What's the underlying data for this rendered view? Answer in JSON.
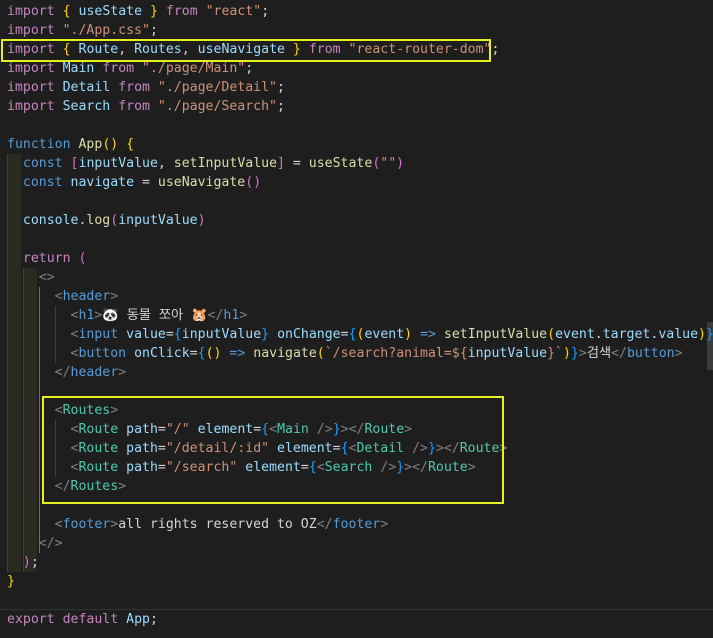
{
  "editor": {
    "language": "javascript-react",
    "theme_colors": {
      "background": "#1e1e1e",
      "highlight_box": "#e6f01e",
      "keyword": "#569cd6",
      "control_keyword": "#c586c0",
      "function": "#dcdcaa",
      "variable": "#9cdcfe",
      "string": "#ce9178",
      "component": "#4ec9b0"
    },
    "lines": [
      {
        "segs": [
          [
            "kw2",
            "import"
          ],
          [
            "txt",
            " "
          ],
          [
            "br1",
            "{"
          ],
          [
            "txt",
            " "
          ],
          [
            "var",
            "useState"
          ],
          [
            "txt",
            " "
          ],
          [
            "br1",
            "}"
          ],
          [
            "txt",
            " "
          ],
          [
            "kw2",
            "from"
          ],
          [
            "txt",
            " "
          ],
          [
            "str",
            "\"react\""
          ],
          [
            "txt",
            ";"
          ]
        ]
      },
      {
        "segs": [
          [
            "kw2",
            "import"
          ],
          [
            "txt",
            " "
          ],
          [
            "str",
            "\"./App.css\""
          ],
          [
            "txt",
            ";"
          ]
        ]
      },
      {
        "segs": [
          [
            "kw2",
            "import"
          ],
          [
            "txt",
            " "
          ],
          [
            "br1",
            "{"
          ],
          [
            "txt",
            " "
          ],
          [
            "var",
            "Route"
          ],
          [
            "txt",
            ", "
          ],
          [
            "var",
            "Routes"
          ],
          [
            "txt",
            ", "
          ],
          [
            "var",
            "useNavigate"
          ],
          [
            "txt",
            " "
          ],
          [
            "br1",
            "}"
          ],
          [
            "txt",
            " "
          ],
          [
            "kw2",
            "from"
          ],
          [
            "txt",
            " "
          ],
          [
            "str",
            "\"react-router-dom\""
          ],
          [
            "txt",
            ";"
          ]
        ]
      },
      {
        "segs": [
          [
            "kw2",
            "import"
          ],
          [
            "txt",
            " "
          ],
          [
            "var",
            "Main"
          ],
          [
            "txt",
            " "
          ],
          [
            "kw2",
            "from"
          ],
          [
            "txt",
            " "
          ],
          [
            "str",
            "\"./page/Main\""
          ],
          [
            "txt",
            ";"
          ]
        ]
      },
      {
        "segs": [
          [
            "kw2",
            "import"
          ],
          [
            "txt",
            " "
          ],
          [
            "var",
            "Detail"
          ],
          [
            "txt",
            " "
          ],
          [
            "kw2",
            "from"
          ],
          [
            "txt",
            " "
          ],
          [
            "str",
            "\"./page/Detail\""
          ],
          [
            "txt",
            ";"
          ]
        ]
      },
      {
        "segs": [
          [
            "kw2",
            "import"
          ],
          [
            "txt",
            " "
          ],
          [
            "var",
            "Search"
          ],
          [
            "txt",
            " "
          ],
          [
            "kw2",
            "from"
          ],
          [
            "txt",
            " "
          ],
          [
            "str",
            "\"./page/Search\""
          ],
          [
            "txt",
            ";"
          ]
        ]
      },
      {
        "segs": []
      },
      {
        "segs": [
          [
            "kw",
            "function"
          ],
          [
            "txt",
            " "
          ],
          [
            "fn",
            "App"
          ],
          [
            "br1",
            "()"
          ],
          [
            "txt",
            " "
          ],
          [
            "br1",
            "{"
          ]
        ]
      },
      {
        "segs": [
          [
            "txt",
            "  "
          ],
          [
            "kw",
            "const"
          ],
          [
            "txt",
            " "
          ],
          [
            "br2",
            "["
          ],
          [
            "var",
            "inputValue"
          ],
          [
            "txt",
            ", "
          ],
          [
            "fn",
            "setInputValue"
          ],
          [
            "br2",
            "]"
          ],
          [
            "txt",
            " = "
          ],
          [
            "fn",
            "useState"
          ],
          [
            "br2",
            "("
          ],
          [
            "str",
            "\"\""
          ],
          [
            "br2",
            ")"
          ]
        ]
      },
      {
        "segs": [
          [
            "txt",
            "  "
          ],
          [
            "kw",
            "const"
          ],
          [
            "txt",
            " "
          ],
          [
            "var",
            "navigate"
          ],
          [
            "txt",
            " = "
          ],
          [
            "fn",
            "useNavigate"
          ],
          [
            "br2",
            "()"
          ]
        ]
      },
      {
        "segs": []
      },
      {
        "segs": [
          [
            "txt",
            "  "
          ],
          [
            "var",
            "console"
          ],
          [
            "txt",
            "."
          ],
          [
            "fn",
            "log"
          ],
          [
            "br2",
            "("
          ],
          [
            "var",
            "inputValue"
          ],
          [
            "br2",
            ")"
          ]
        ]
      },
      {
        "segs": []
      },
      {
        "segs": [
          [
            "txt",
            "  "
          ],
          [
            "kw2",
            "return"
          ],
          [
            "txt",
            " "
          ],
          [
            "br2",
            "("
          ]
        ]
      },
      {
        "segs": [
          [
            "txt",
            "    "
          ],
          [
            "punc",
            "<>"
          ]
        ]
      },
      {
        "segs": [
          [
            "txt",
            "      "
          ],
          [
            "punc",
            "<"
          ],
          [
            "tag",
            "header"
          ],
          [
            "punc",
            ">"
          ]
        ]
      },
      {
        "segs": [
          [
            "txt",
            "        "
          ],
          [
            "punc",
            "<"
          ],
          [
            "tag",
            "h1"
          ],
          [
            "punc",
            ">"
          ],
          [
            "emoji",
            "🐼"
          ],
          [
            "txt",
            " 동물 쪼아 "
          ],
          [
            "emoji",
            "🐹"
          ],
          [
            "punc",
            "</"
          ],
          [
            "tag",
            "h1"
          ],
          [
            "punc",
            ">"
          ]
        ]
      },
      {
        "segs": [
          [
            "txt",
            "        "
          ],
          [
            "punc",
            "<"
          ],
          [
            "tag",
            "input"
          ],
          [
            "txt",
            " "
          ],
          [
            "attr",
            "value"
          ],
          [
            "txt",
            "="
          ],
          [
            "br3",
            "{"
          ],
          [
            "var",
            "inputValue"
          ],
          [
            "br3",
            "}"
          ],
          [
            "txt",
            " "
          ],
          [
            "attr",
            "onChange"
          ],
          [
            "txt",
            "="
          ],
          [
            "br3",
            "{"
          ],
          [
            "br1",
            "("
          ],
          [
            "var",
            "event"
          ],
          [
            "br1",
            ")"
          ],
          [
            "txt",
            " "
          ],
          [
            "kw",
            "=>"
          ],
          [
            "txt",
            " "
          ],
          [
            "fn",
            "setInputValue"
          ],
          [
            "br1",
            "("
          ],
          [
            "var",
            "event"
          ],
          [
            "txt",
            "."
          ],
          [
            "var",
            "target"
          ],
          [
            "txt",
            "."
          ],
          [
            "var",
            "value"
          ],
          [
            "br1",
            ")"
          ],
          [
            "br3",
            "}"
          ],
          [
            "punc",
            "/>"
          ]
        ]
      },
      {
        "segs": [
          [
            "txt",
            "        "
          ],
          [
            "punc",
            "<"
          ],
          [
            "tag",
            "button"
          ],
          [
            "txt",
            " "
          ],
          [
            "attr",
            "onClick"
          ],
          [
            "txt",
            "="
          ],
          [
            "br3",
            "{"
          ],
          [
            "br1",
            "()"
          ],
          [
            "txt",
            " "
          ],
          [
            "kw",
            "=>"
          ],
          [
            "txt",
            " "
          ],
          [
            "fn",
            "navigate"
          ],
          [
            "br1",
            "("
          ],
          [
            "str",
            "`/search?animal=${"
          ],
          [
            "var",
            "inputValue"
          ],
          [
            "str",
            "}`"
          ],
          [
            "br1",
            ")"
          ],
          [
            "br3",
            "}"
          ],
          [
            "punc",
            ">"
          ],
          [
            "txt",
            "검색"
          ],
          [
            "punc",
            "</"
          ],
          [
            "tag",
            "button"
          ],
          [
            "punc",
            ">"
          ]
        ]
      },
      {
        "segs": [
          [
            "txt",
            "      "
          ],
          [
            "punc",
            "</"
          ],
          [
            "tag",
            "header"
          ],
          [
            "punc",
            ">"
          ]
        ]
      },
      {
        "segs": []
      },
      {
        "segs": [
          [
            "txt",
            "      "
          ],
          [
            "punc",
            "<"
          ],
          [
            "comp",
            "Routes"
          ],
          [
            "punc",
            ">"
          ]
        ]
      },
      {
        "segs": [
          [
            "txt",
            "        "
          ],
          [
            "punc",
            "<"
          ],
          [
            "comp",
            "Route"
          ],
          [
            "txt",
            " "
          ],
          [
            "attr",
            "path"
          ],
          [
            "txt",
            "="
          ],
          [
            "str",
            "\"/\""
          ],
          [
            "txt",
            " "
          ],
          [
            "attr",
            "element"
          ],
          [
            "txt",
            "="
          ],
          [
            "br3",
            "{"
          ],
          [
            "punc",
            "<"
          ],
          [
            "comp",
            "Main"
          ],
          [
            "txt",
            " "
          ],
          [
            "punc",
            "/>"
          ],
          [
            "br3",
            "}"
          ],
          [
            "punc",
            "></"
          ],
          [
            "comp",
            "Route"
          ],
          [
            "punc",
            ">"
          ]
        ]
      },
      {
        "segs": [
          [
            "txt",
            "        "
          ],
          [
            "punc",
            "<"
          ],
          [
            "comp",
            "Route"
          ],
          [
            "txt",
            " "
          ],
          [
            "attr",
            "path"
          ],
          [
            "txt",
            "="
          ],
          [
            "str",
            "\"/detail/:id\""
          ],
          [
            "txt",
            " "
          ],
          [
            "attr",
            "element"
          ],
          [
            "txt",
            "="
          ],
          [
            "br3",
            "{"
          ],
          [
            "punc",
            "<"
          ],
          [
            "comp",
            "Detail"
          ],
          [
            "txt",
            " "
          ],
          [
            "punc",
            "/>"
          ],
          [
            "br3",
            "}"
          ],
          [
            "punc",
            "></"
          ],
          [
            "comp",
            "Route"
          ],
          [
            "punc",
            ">"
          ]
        ]
      },
      {
        "segs": [
          [
            "txt",
            "        "
          ],
          [
            "punc",
            "<"
          ],
          [
            "comp",
            "Route"
          ],
          [
            "txt",
            " "
          ],
          [
            "attr",
            "path"
          ],
          [
            "txt",
            "="
          ],
          [
            "str",
            "\"/search\""
          ],
          [
            "txt",
            " "
          ],
          [
            "attr",
            "element"
          ],
          [
            "txt",
            "="
          ],
          [
            "br3",
            "{"
          ],
          [
            "punc",
            "<"
          ],
          [
            "comp",
            "Search"
          ],
          [
            "txt",
            " "
          ],
          [
            "punc",
            "/>"
          ],
          [
            "br3",
            "}"
          ],
          [
            "punc",
            "></"
          ],
          [
            "comp",
            "Route"
          ],
          [
            "punc",
            ">"
          ]
        ]
      },
      {
        "segs": [
          [
            "txt",
            "      "
          ],
          [
            "punc",
            "</"
          ],
          [
            "comp",
            "Routes"
          ],
          [
            "punc",
            ">"
          ]
        ]
      },
      {
        "segs": []
      },
      {
        "segs": [
          [
            "txt",
            "      "
          ],
          [
            "punc",
            "<"
          ],
          [
            "tag",
            "footer"
          ],
          [
            "punc",
            ">"
          ],
          [
            "txt",
            "all rights reserved to OZ"
          ],
          [
            "punc",
            "</"
          ],
          [
            "tag",
            "footer"
          ],
          [
            "punc",
            ">"
          ]
        ]
      },
      {
        "segs": [
          [
            "txt",
            "    "
          ],
          [
            "punc",
            "</>"
          ]
        ]
      },
      {
        "segs": [
          [
            "txt",
            "  "
          ],
          [
            "br2",
            ")"
          ],
          [
            "txt",
            ";"
          ]
        ]
      },
      {
        "segs": [
          [
            "br1",
            "}"
          ]
        ]
      },
      {
        "segs": []
      },
      {
        "segs": [
          [
            "kw2",
            "export"
          ],
          [
            "txt",
            " "
          ],
          [
            "kw2",
            "default"
          ],
          [
            "txt",
            " "
          ],
          [
            "var",
            "App"
          ],
          [
            "txt",
            ";"
          ]
        ]
      }
    ]
  }
}
